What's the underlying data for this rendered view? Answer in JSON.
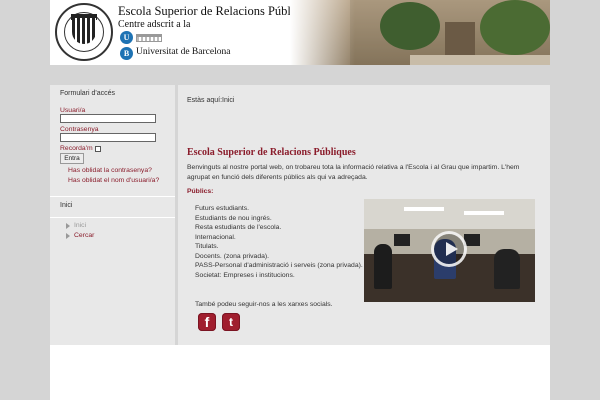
{
  "header": {
    "logo_alt": "RRPP",
    "school_title": "Escola Superior de Relacions Públiques",
    "centre_line": "Centre adscrit a la",
    "ub_letter_u": "U",
    "ub_letter_b": "B",
    "ub_name": "Universitat de Barcelona"
  },
  "login": {
    "title": "Formulari d'accés",
    "user_label": "Usuari/a",
    "user_value": "",
    "password_label": "Contrasenya",
    "password_value": "",
    "remember_label": "Recorda'm",
    "remember_checked": false,
    "submit_label": "Entra",
    "forgot_password": "Has oblidat la contrasenya?",
    "forgot_username": "Has oblidat el nom d'usuari/a?"
  },
  "menu": {
    "title": "Inici",
    "items": [
      {
        "label": "Inici",
        "active": true
      },
      {
        "label": "Cercar",
        "active": false
      }
    ]
  },
  "main": {
    "breadcrumb": "Estàs aquí:Inici",
    "title": "Escola Superior de Relacions Públiques",
    "intro": "Benvinguts al nostre portal web, on trobareu tota la informació relativa a l'Escola i al Grau que impartim. L'hem agrupat en funció dels diferents públics als qui va adreçada.",
    "publics_label": "Públics:",
    "publics": [
      "Futurs estudiants.",
      "Estudiants de nou ingrés.",
      "Resta estudiants de l'escola.",
      "Internacional.",
      "Titulats.",
      "Docents. (zona privada).",
      "PASS-Personal d'administració i serveis (zona privada).",
      "Societat: Empreses i institucions."
    ],
    "social_text": "També podeu seguir-nos a les xarxes socials.",
    "video_icon": "play-icon"
  },
  "social": {
    "facebook_glyph": "f",
    "twitter_glyph": "t"
  },
  "colors": {
    "accent": "#8a1c2b",
    "background": "#d5d5d5",
    "panel": "#e8e8e8",
    "ub_blue": "#1e73b4"
  }
}
